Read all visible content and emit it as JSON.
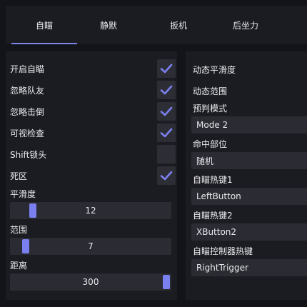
{
  "tabs": [
    {
      "label": "自瞄",
      "active": true
    },
    {
      "label": "静默",
      "active": false
    },
    {
      "label": "扳机",
      "active": false
    },
    {
      "label": "后坐力",
      "active": false
    }
  ],
  "left_panel": {
    "toggles": [
      {
        "label": "开启自瞄",
        "checked": true
      },
      {
        "label": "忽略队友",
        "checked": true
      },
      {
        "label": "忽略击倒",
        "checked": true
      },
      {
        "label": "可视检查",
        "checked": true
      },
      {
        "label": "Shift锁头",
        "checked": false
      },
      {
        "label": "死区",
        "checked": true
      }
    ],
    "sliders": [
      {
        "label": "平滑度",
        "value": "12",
        "fraction": 0.12
      },
      {
        "label": "范围",
        "value": "7",
        "fraction": 0.07
      },
      {
        "label": "距离",
        "value": "300",
        "fraction": 1.0
      }
    ]
  },
  "right_panel": {
    "dynamic_smooth_label": "动态平滑度",
    "dynamic_range_label": "动态范围",
    "prediction": {
      "label": "预判模式",
      "value": "Mode 2"
    },
    "hit_part": {
      "label": "命中部位",
      "value": "随机"
    },
    "hotkey1": {
      "label": "自瞄热键1",
      "value": "LeftButton"
    },
    "hotkey2": {
      "label": "自瞄热键2",
      "value": "XButton2"
    },
    "controller_hotkey": {
      "label": "自瞄控制器热键",
      "value": "RightTrigger"
    }
  },
  "colors": {
    "accent": "#7b80f0",
    "panel": "#1b1c21",
    "background": "#131419",
    "control": "#2b2c33"
  }
}
